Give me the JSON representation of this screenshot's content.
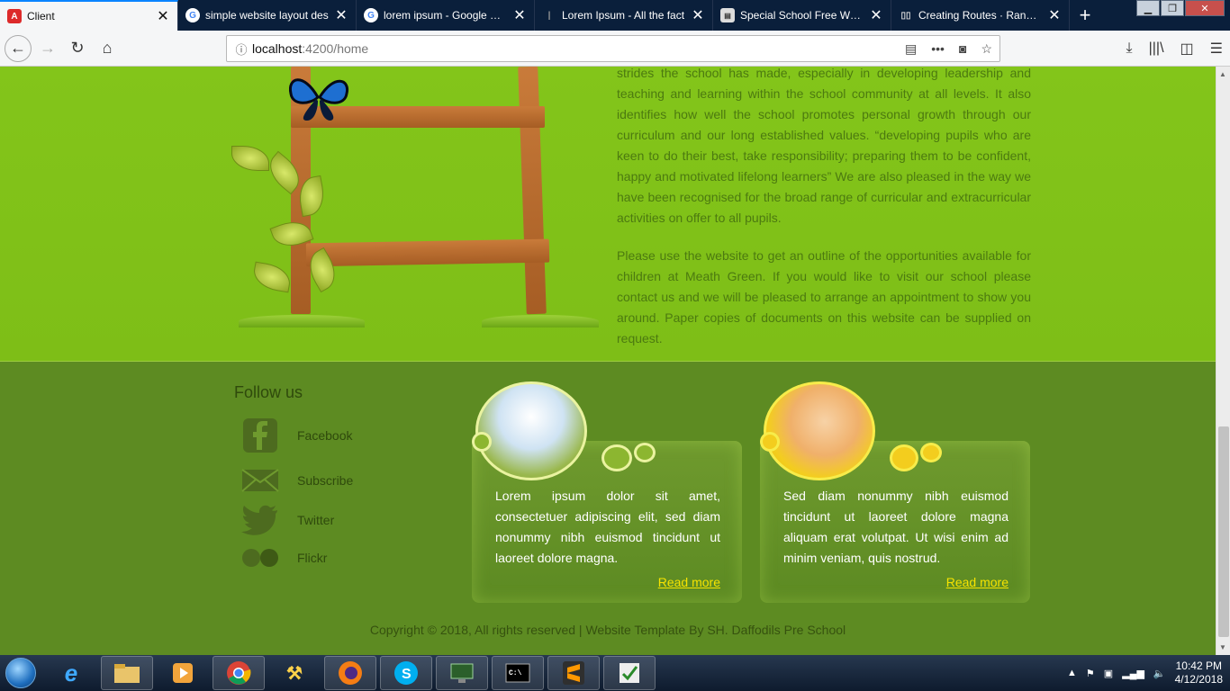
{
  "browser": {
    "tabs": [
      {
        "title": "Client",
        "favicon": "angular-icon",
        "active": true
      },
      {
        "title": "simple website layout des",
        "favicon": "google-icon",
        "active": false
      },
      {
        "title": "lorem ipsum - Google Sea",
        "favicon": "google-icon",
        "active": false
      },
      {
        "title": "Lorem Ipsum - All the fact",
        "favicon": "lipsum-icon",
        "active": false
      },
      {
        "title": "Special School Free Websi",
        "favicon": "template-icon",
        "active": false
      },
      {
        "title": "Creating Routes · Rangle.i",
        "favicon": "book-icon",
        "active": false
      }
    ],
    "url_host": "localhost",
    "url_path": ":4200/home"
  },
  "page": {
    "paragraph1": "strides the school has made, especially in developing leadership and teaching and learning within the school community at all levels. It also identifies how well the school promotes personal growth through our curriculum and our long established values. “developing pupils who are keen to do their best, take responsibility; preparing them to be confident, happy and motivated lifelong learners” We are also pleased in the way we have been recognised for the broad range of curricular and extracurricular activities on offer to all pupils.",
    "paragraph2": "Please use the website to get an outline of the opportunities available for children at Meath Green. If you would like to visit our school please contact us and we will be pleased to arrange an appointment to show you around. Paper copies of documents on this website can be supplied on request."
  },
  "footer": {
    "follow_title": "Follow us",
    "social": [
      {
        "label": "Facebook",
        "icon": "facebook-icon"
      },
      {
        "label": "Subscribe",
        "icon": "envelope-icon"
      },
      {
        "label": "Twitter",
        "icon": "twitter-icon"
      },
      {
        "label": "Flickr",
        "icon": "flickr-icon"
      }
    ],
    "cards": [
      {
        "text": "Lorem ipsum dolor sit amet, consectetuer adipiscing elit, sed diam nonummy nibh euismod tincidunt ut laoreet dolore magna.",
        "link": "Read more",
        "image": "child-running-photo"
      },
      {
        "text": "Sed diam nonummy nibh euismod tincidunt ut laoreet dolore magna aliquam erat volutpat. Ut wisi enim ad minim veniam, quis nostrud.",
        "link": "Read more",
        "image": "baby-photo"
      }
    ],
    "copyright": "Copyright © 2018, All rights reserved | Website Template By SH. Daffodils Pre School"
  },
  "taskbar": {
    "apps": [
      "internet-explorer-icon",
      "file-explorer-icon",
      "media-player-icon",
      "chrome-icon",
      "tools-icon",
      "firefox-icon",
      "skype-icon",
      "network-icon",
      "cmd-icon",
      "sublime-icon",
      "task-icon"
    ],
    "time": "10:42 PM",
    "date": "4/12/2018"
  }
}
